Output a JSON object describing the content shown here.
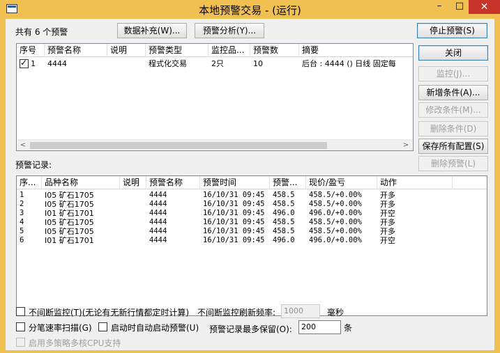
{
  "window": {
    "title": "本地预警交易 - (运行)",
    "minimize_glyph": "–",
    "maximize_glyph": "□",
    "close_glyph": "✕"
  },
  "top": {
    "count_label": "共有 6 个预警",
    "data_fill_button": "数据补充(W)...",
    "analysis_button": "预警分析(Y)...",
    "stop_button": "停止预警(S)"
  },
  "alerts_table": {
    "columns": [
      "序号",
      "预警名称",
      "说明",
      "预警类型",
      "监控品...",
      "预警数",
      "摘要"
    ],
    "rows": [
      {
        "checked": true,
        "check_glyph": "✓",
        "no": "1",
        "name": "4444",
        "desc": "",
        "type": "程式化交易",
        "monitor": "2只",
        "count": "10",
        "summary": "后台 : 4444 () 日线 固定每"
      }
    ],
    "scroll_left": "<",
    "scroll_right": ">"
  },
  "side_buttons": {
    "close": "关闭",
    "monitor": "监控(J)...",
    "add_condition": "新增条件(A)...",
    "edit_condition": "修改条件(M)...",
    "delete_condition": "删除条件(D)",
    "save_all": "保存所有配置(S)",
    "delete_alert": "删除预警(L)"
  },
  "records": {
    "label": "预警记录:",
    "columns": [
      "序...",
      "品种名称",
      "说明",
      "预警名称",
      "预警时间",
      "预警...",
      "现价/盈亏",
      "动作"
    ],
    "rows": [
      {
        "no": "1",
        "product": "I05 矿石1705",
        "desc": "",
        "alert": "4444",
        "time": "16/10/31 09:45",
        "price": "458.5",
        "pnl": "458.5/+0.00%",
        "action": "开多"
      },
      {
        "no": "2",
        "product": "I05 矿石1705",
        "desc": "",
        "alert": "4444",
        "time": "16/10/31 09:45",
        "price": "458.5",
        "pnl": "458.5/+0.00%",
        "action": "开多"
      },
      {
        "no": "3",
        "product": "I01 矿石1701",
        "desc": "",
        "alert": "4444",
        "time": "16/10/31 09:45",
        "price": "496.0",
        "pnl": "496.0/+0.00%",
        "action": "开空"
      },
      {
        "no": "4",
        "product": "I05 矿石1705",
        "desc": "",
        "alert": "4444",
        "time": "16/10/31 09:45",
        "price": "458.5",
        "pnl": "458.5/+0.00%",
        "action": "开多"
      },
      {
        "no": "5",
        "product": "I05 矿石1705",
        "desc": "",
        "alert": "4444",
        "time": "16/10/31 09:45",
        "price": "458.5",
        "pnl": "458.5/+0.00%",
        "action": "开多"
      },
      {
        "no": "6",
        "product": "I01 矿石1701",
        "desc": "",
        "alert": "4444",
        "time": "16/10/31 09:45",
        "price": "496.0",
        "pnl": "496.0/+0.00%",
        "action": "开空"
      }
    ]
  },
  "options": {
    "continuous_monitor": {
      "label": "不间断监控(T)(无论有无新行情都定时计算)",
      "checked": false
    },
    "refresh_label": "不间断监控刷新频率:",
    "refresh_value": "1000",
    "refresh_unit": "毫秒",
    "tick_scan": {
      "label": "分笔速率扫描(G)",
      "checked": false
    },
    "auto_start": {
      "label": "启动时自动启动预警(U)",
      "checked": false
    },
    "keep_label": "预警记录最多保留(O):",
    "keep_value": "200",
    "keep_unit": "条",
    "multicore": {
      "label": "启用多策略多核CPU支持",
      "checked": false
    }
  }
}
